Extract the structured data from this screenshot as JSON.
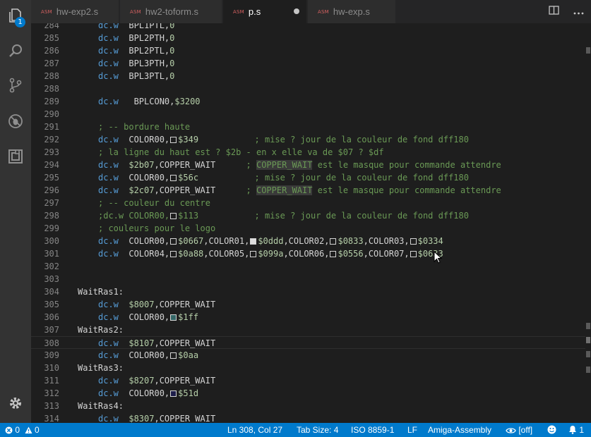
{
  "tabs": [
    {
      "type": "ASM",
      "label": "hw-exp2.s",
      "active": false
    },
    {
      "type": "ASM",
      "label": "hw2-toform.s",
      "active": false
    },
    {
      "type": "ASM",
      "label": "p.s",
      "active": true,
      "dirty": true
    },
    {
      "type": "ASM",
      "label": "hw-exp.s",
      "active": false
    }
  ],
  "activity": {
    "explorer_badge": "1"
  },
  "icons": {
    "explorer": "files-icon",
    "search": "search-icon",
    "scm": "source-control-icon",
    "debug": "debug-icon",
    "extensions": "extensions-icon",
    "settings": "gear-icon",
    "split": "split-editor-icon",
    "more": "more-icon"
  },
  "colors": {
    "accent": "#007acc",
    "keyword": "#569cd6",
    "number": "#b5cea8",
    "comment": "#6a9955"
  },
  "editor": {
    "lines": [
      {
        "n": "284",
        "i": 1,
        "t": [
          [
            "kw",
            "dc.w"
          ],
          [
            "",
            "  BPL1PTL,"
          ],
          [
            "num",
            "0"
          ]
        ]
      },
      {
        "n": "285",
        "i": 1,
        "t": [
          [
            "kw",
            "dc.w"
          ],
          [
            "",
            "  BPL2PTH,"
          ],
          [
            "num",
            "0"
          ]
        ]
      },
      {
        "n": "286",
        "i": 1,
        "t": [
          [
            "kw",
            "dc.w"
          ],
          [
            "",
            "  BPL2PTL,"
          ],
          [
            "num",
            "0"
          ]
        ]
      },
      {
        "n": "287",
        "i": 1,
        "t": [
          [
            "kw",
            "dc.w"
          ],
          [
            "",
            "  BPL3PTH,"
          ],
          [
            "num",
            "0"
          ]
        ]
      },
      {
        "n": "288",
        "i": 1,
        "t": [
          [
            "kw",
            "dc.w"
          ],
          [
            "",
            "  BPL3PTL,"
          ],
          [
            "num",
            "0"
          ]
        ]
      },
      {
        "n": "288",
        "i": 0,
        "t": []
      },
      {
        "n": "289",
        "i": 1,
        "t": [
          [
            "kw",
            "dc.w"
          ],
          [
            "",
            "   BPLCON0,"
          ],
          [
            "num",
            "$3200"
          ]
        ]
      },
      {
        "n": "290",
        "i": 0,
        "t": []
      },
      {
        "n": "291",
        "i": 1,
        "t": [
          [
            "cm",
            "; -- bordure haute"
          ]
        ]
      },
      {
        "n": "292",
        "i": 1,
        "t": [
          [
            "kw",
            "dc.w"
          ],
          [
            "",
            "  COLOR00,"
          ],
          [
            "sw",
            "#1e1e1e"
          ],
          [
            "num",
            "$349"
          ],
          [
            "cm",
            "           ; mise ? jour de la couleur de fond dff180"
          ]
        ]
      },
      {
        "n": "293",
        "i": 1,
        "t": [
          [
            "cm",
            "; la ligne du haut est ? $2b - en x elle va de $07 ? $df"
          ]
        ]
      },
      {
        "n": "294",
        "i": 1,
        "t": [
          [
            "kw",
            "dc.w"
          ],
          [
            "",
            "  "
          ],
          [
            "num",
            "$2b07"
          ],
          [
            "",
            ",COPPER_WAIT"
          ],
          [
            "cm",
            "      ; "
          ],
          [
            "hlcm",
            "COPPER_WAIT"
          ],
          [
            "cm",
            " est le masque pour commande attendre"
          ]
        ]
      },
      {
        "n": "295",
        "i": 1,
        "t": [
          [
            "kw",
            "dc.w"
          ],
          [
            "",
            "  COLOR00,"
          ],
          [
            "sw",
            "#1e1e1e"
          ],
          [
            "num",
            "$56c"
          ],
          [
            "cm",
            "           ; mise ? jour de la couleur de fond dff180"
          ]
        ]
      },
      {
        "n": "296",
        "i": 1,
        "t": [
          [
            "kw",
            "dc.w"
          ],
          [
            "",
            "  "
          ],
          [
            "num",
            "$2c07"
          ],
          [
            "",
            ",COPPER_WAIT"
          ],
          [
            "cm",
            "      ; "
          ],
          [
            "hlcm",
            "COPPER_WAIT"
          ],
          [
            "cm",
            " est le masque pour commande attendre"
          ]
        ]
      },
      {
        "n": "297",
        "i": 1,
        "t": [
          [
            "cm",
            "; -- couleur du centre"
          ]
        ]
      },
      {
        "n": "298",
        "i": 1,
        "t": [
          [
            "cm",
            ";dc.w COLOR00,"
          ],
          [
            "sw",
            "#1e1e1e"
          ],
          [
            "cm",
            "$113           ; mise ? jour de la couleur de fond dff180"
          ]
        ]
      },
      {
        "n": "299",
        "i": 1,
        "t": [
          [
            "cm",
            "; couleurs pour le logo"
          ]
        ]
      },
      {
        "n": "300",
        "i": 1,
        "t": [
          [
            "kw",
            "dc.w"
          ],
          [
            "",
            "  COLOR00,"
          ],
          [
            "sw",
            "#1e1e1e"
          ],
          [
            "num",
            "$0667"
          ],
          [
            "",
            ",COLOR01,"
          ],
          [
            "sw",
            "#dddddd"
          ],
          [
            "num",
            "$0ddd"
          ],
          [
            "",
            ",COLOR02,"
          ],
          [
            "sw",
            "#1e1e1e"
          ],
          [
            "num",
            "$0833"
          ],
          [
            "",
            ",COLOR03,"
          ],
          [
            "sw",
            "#1e1e1e"
          ],
          [
            "num",
            "$0334"
          ]
        ]
      },
      {
        "n": "301",
        "i": 1,
        "t": [
          [
            "kw",
            "dc.w"
          ],
          [
            "",
            "  COLOR04,"
          ],
          [
            "sw",
            "#1e1e1e"
          ],
          [
            "num",
            "$0a88"
          ],
          [
            "",
            ",COLOR05,"
          ],
          [
            "sw",
            "#1e1e1e"
          ],
          [
            "num",
            "$099a"
          ],
          [
            "",
            ",COLOR06,"
          ],
          [
            "sw",
            "#1e1e1e"
          ],
          [
            "num",
            "$0556"
          ],
          [
            "",
            ",COLOR07,"
          ],
          [
            "sw",
            "#1e1e1e"
          ],
          [
            "num",
            "$0633"
          ]
        ]
      },
      {
        "n": "302",
        "i": 0,
        "t": []
      },
      {
        "n": "303",
        "i": 0,
        "t": []
      },
      {
        "n": "304",
        "i": 0,
        "t": [
          [
            "lbl",
            "WaitRas1:"
          ]
        ]
      },
      {
        "n": "305",
        "i": 1,
        "t": [
          [
            "kw",
            "dc.w"
          ],
          [
            "",
            "  "
          ],
          [
            "num",
            "$8007"
          ],
          [
            "",
            ",COPPER_WAIT"
          ]
        ]
      },
      {
        "n": "306",
        "i": 1,
        "t": [
          [
            "kw",
            "dc.w"
          ],
          [
            "",
            "  COLOR00,"
          ],
          [
            "sw",
            "#336666"
          ],
          [
            "num",
            "$1ff"
          ]
        ]
      },
      {
        "n": "307",
        "i": 0,
        "t": [
          [
            "lbl",
            "WaitRas2:"
          ]
        ]
      },
      {
        "n": "308",
        "i": 1,
        "cur": true,
        "t": [
          [
            "kw",
            "dc.w"
          ],
          [
            "",
            "  "
          ],
          [
            "num",
            "$8107"
          ],
          [
            "",
            ",COPPER_WAIT"
          ]
        ]
      },
      {
        "n": "309",
        "i": 1,
        "t": [
          [
            "kw",
            "dc.w"
          ],
          [
            "",
            "  COLOR00,"
          ],
          [
            "sw",
            "#1e1e1e"
          ],
          [
            "num",
            "$0aa"
          ]
        ]
      },
      {
        "n": "310",
        "i": 0,
        "t": [
          [
            "lbl",
            "WaitRas3:"
          ]
        ]
      },
      {
        "n": "311",
        "i": 1,
        "t": [
          [
            "kw",
            "dc.w"
          ],
          [
            "",
            "  "
          ],
          [
            "num",
            "$8207"
          ],
          [
            "",
            ",COPPER_WAIT"
          ]
        ]
      },
      {
        "n": "312",
        "i": 1,
        "t": [
          [
            "kw",
            "dc.w"
          ],
          [
            "",
            "  COLOR00,"
          ],
          [
            "sw",
            "#1e1e4a"
          ],
          [
            "num",
            "$51d"
          ]
        ]
      },
      {
        "n": "313",
        "i": 0,
        "t": [
          [
            "lbl",
            "WaitRas4:"
          ]
        ]
      },
      {
        "n": "314",
        "i": 1,
        "t": [
          [
            "kw",
            "dc.w"
          ],
          [
            "",
            "  "
          ],
          [
            "num",
            "$8307"
          ],
          [
            "",
            ",COPPER_WAIT"
          ]
        ]
      }
    ]
  },
  "status": {
    "errors": "0",
    "warnings": "0",
    "position": "Ln 308, Col 27",
    "tab_size": "Tab Size: 4",
    "encoding": "ISO 8859-1",
    "eol": "LF",
    "language": "Amiga-Assembly",
    "eye_state": "[off]",
    "notifications": "1"
  }
}
